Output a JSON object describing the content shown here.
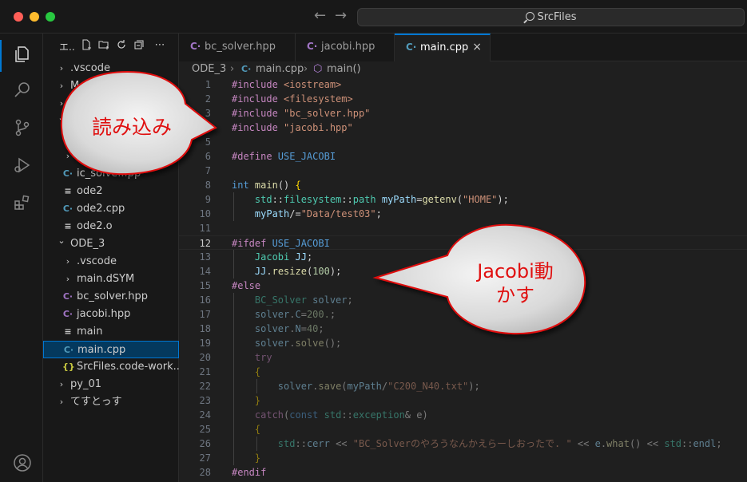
{
  "window": {
    "title": "SrcFiles"
  },
  "sidebar": {
    "title": "エ..",
    "items": [
      {
        "label": ".vscode",
        "kind": "folder",
        "expanded": false,
        "level": 0
      },
      {
        "label": "M...",
        "kind": "folder",
        "expanded": false,
        "level": 0
      },
      {
        "label": "",
        "kind": "folder",
        "expanded": false,
        "level": 0
      },
      {
        "label": "",
        "kind": "folder",
        "expanded": true,
        "level": 0
      },
      {
        "label": "",
        "kind": "folder",
        "expanded": false,
        "level": 1
      },
      {
        "label": "",
        "kind": "folder",
        "expanded": false,
        "level": 1
      },
      {
        "label": "ic_solve...pp",
        "kind": "cpp",
        "level": 1
      },
      {
        "label": "ode2",
        "kind": "text",
        "level": 1
      },
      {
        "label": "ode2.cpp",
        "kind": "cpp",
        "level": 1
      },
      {
        "label": "ode2.o",
        "kind": "text",
        "level": 1
      },
      {
        "label": "ODE_3",
        "kind": "folder",
        "expanded": true,
        "level": 0
      },
      {
        "label": ".vscode",
        "kind": "folder",
        "expanded": false,
        "level": 1
      },
      {
        "label": "main.dSYM",
        "kind": "folder",
        "expanded": false,
        "level": 1
      },
      {
        "label": "bc_solver.hpp",
        "kind": "hpp",
        "level": 1
      },
      {
        "label": "jacobi.hpp",
        "kind": "hpp",
        "level": 1
      },
      {
        "label": "main",
        "kind": "text",
        "level": 1
      },
      {
        "label": "main.cpp",
        "kind": "cpp",
        "level": 1,
        "selected": true
      },
      {
        "label": "SrcFiles.code-work...",
        "kind": "json",
        "level": 1
      },
      {
        "label": "py_01",
        "kind": "folder",
        "expanded": false,
        "level": 0
      },
      {
        "label": "てすとっす",
        "kind": "folder",
        "expanded": false,
        "level": 0
      }
    ]
  },
  "tabs": [
    {
      "label": "bc_solver.hpp",
      "icon": "hpp-file-icon",
      "active": false
    },
    {
      "label": "jacobi.hpp",
      "icon": "hpp-file-icon",
      "active": false
    },
    {
      "label": "main.cpp",
      "icon": "cpp-file-icon",
      "active": true,
      "close": "×"
    }
  ],
  "breadcrumb": {
    "folder": "ODE_3",
    "file": "main.cpp",
    "symbol": "main()"
  },
  "editor": {
    "current_line": 12,
    "lines": [
      [
        [
          "#include ",
          "pp"
        ],
        [
          "<iostream>",
          "str"
        ]
      ],
      [
        [
          "#include ",
          "pp"
        ],
        [
          "<filesystem>",
          "str"
        ]
      ],
      [
        [
          "#include ",
          "pp"
        ],
        [
          "\"bc_solver.hpp\"",
          "str"
        ]
      ],
      [
        [
          "#include ",
          "pp"
        ],
        [
          "\"jacobi.hpp\"",
          "str"
        ]
      ],
      [],
      [
        [
          "#define ",
          "pp"
        ],
        [
          "USE_JACOBI",
          "macro"
        ]
      ],
      [],
      [
        [
          "int ",
          "kw"
        ],
        [
          "main",
          "fn"
        ],
        [
          "() ",
          ""
        ],
        [
          "{",
          "brace"
        ]
      ],
      [
        [
          "    std",
          "ns"
        ],
        [
          "::",
          ""
        ],
        [
          "filesystem",
          "ns"
        ],
        [
          "::",
          ""
        ],
        [
          "path ",
          "type"
        ],
        [
          "myPath",
          "var"
        ],
        [
          "=",
          ""
        ],
        [
          "getenv",
          "fn"
        ],
        [
          "(",
          ""
        ],
        [
          "\"HOME\"",
          "str"
        ],
        [
          ");",
          ""
        ]
      ],
      [
        [
          "    myPath",
          "var"
        ],
        [
          "/=",
          ""
        ],
        [
          "\"Data/test03\"",
          "str"
        ],
        [
          ";",
          ""
        ]
      ],
      [],
      [
        [
          "#ifdef ",
          "pp"
        ],
        [
          "USE_JACOBI",
          "macro"
        ]
      ],
      [
        [
          "    Jacobi ",
          "type"
        ],
        [
          "JJ",
          "var"
        ],
        [
          ";",
          ""
        ]
      ],
      [
        [
          "    JJ",
          "var"
        ],
        [
          ".",
          ""
        ],
        [
          "resize",
          "fn"
        ],
        [
          "(",
          ""
        ],
        [
          "100",
          "num"
        ],
        [
          ");",
          ""
        ]
      ],
      [
        [
          "#else",
          "pp"
        ]
      ],
      [
        [
          "    BC_Solver ",
          "dtype"
        ],
        [
          "solver",
          "dvar"
        ],
        [
          ";",
          "d"
        ]
      ],
      [
        [
          "    solver",
          "dvar"
        ],
        [
          ".",
          "d"
        ],
        [
          "C",
          "dvar"
        ],
        [
          "=",
          "d"
        ],
        [
          "200.",
          "dnum"
        ],
        [
          ";",
          "d"
        ]
      ],
      [
        [
          "    solver",
          "dvar"
        ],
        [
          ".",
          "d"
        ],
        [
          "N",
          "dvar"
        ],
        [
          "=",
          "d"
        ],
        [
          "40",
          "dnum"
        ],
        [
          ";",
          "d"
        ]
      ],
      [
        [
          "    solver",
          "dvar"
        ],
        [
          ".",
          "d"
        ],
        [
          "solve",
          "dfn"
        ],
        [
          "();",
          "d"
        ]
      ],
      [
        [
          "    try",
          "dpp"
        ]
      ],
      [
        [
          "    {",
          "dbrace"
        ]
      ],
      [
        [
          "        solver",
          "dvar"
        ],
        [
          ".",
          "d"
        ],
        [
          "save",
          "dfn"
        ],
        [
          "(",
          "d"
        ],
        [
          "myPath",
          "dvar"
        ],
        [
          "/",
          "d"
        ],
        [
          "\"C200_N40.txt\"",
          "dstr"
        ],
        [
          ");",
          "d"
        ]
      ],
      [
        [
          "    }",
          "dbrace"
        ]
      ],
      [
        [
          "    catch",
          "dpp"
        ],
        [
          "(",
          "d"
        ],
        [
          "const ",
          "dkw"
        ],
        [
          "std",
          "dns"
        ],
        [
          "::",
          "d"
        ],
        [
          "exception",
          "dtype"
        ],
        [
          "& e)",
          "d"
        ]
      ],
      [
        [
          "    {",
          "dbrace"
        ]
      ],
      [
        [
          "        std",
          "dns"
        ],
        [
          "::",
          "d"
        ],
        [
          "cerr ",
          "dvar"
        ],
        [
          "<< ",
          "d"
        ],
        [
          "\"BC_Solverのやろうなんかえらーしおったで. \"",
          "dstr"
        ],
        [
          " << ",
          "d"
        ],
        [
          "e",
          "dvar"
        ],
        [
          ".",
          "d"
        ],
        [
          "what",
          "dfn"
        ],
        [
          "()",
          "d"
        ],
        [
          " << ",
          "d"
        ],
        [
          "std",
          "dns"
        ],
        [
          "::",
          "d"
        ],
        [
          "endl",
          "dvar"
        ],
        [
          ";",
          "d"
        ]
      ],
      [
        [
          "    }",
          "dbrace"
        ]
      ],
      [
        [
          "#endif",
          "pp"
        ]
      ]
    ]
  },
  "callouts": [
    {
      "text": "読み込み"
    },
    {
      "text_line1": "Jacobi動",
      "text_line2": "かす"
    }
  ],
  "colors": {
    "accent": "#0078d4",
    "callout_text": "#e01010",
    "callout_stroke": "#e01010"
  }
}
